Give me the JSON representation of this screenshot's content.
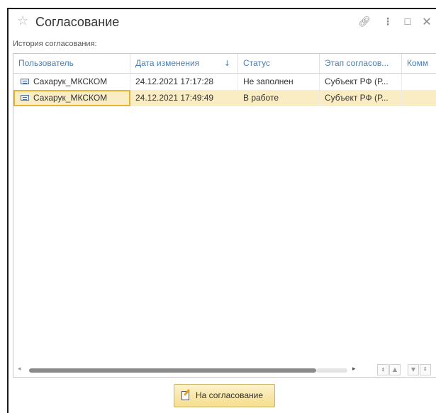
{
  "window": {
    "title": "Согласование",
    "icons": [
      "star-icon",
      "link-icon",
      "more-icon",
      "maximize-icon",
      "close-icon"
    ]
  },
  "history": {
    "label": "История согласования:",
    "columns": [
      "Пользователь",
      "Дата изменения",
      "Статус",
      "Этап согласов...",
      "Комм"
    ],
    "sort_indicator": "↓",
    "rows": [
      {
        "user": "Сахарук_МКСКОМ",
        "date": "24.12.2021 17:17:28",
        "status": "Не заполнен",
        "stage": "Субъект РФ (Р...",
        "comment": ""
      },
      {
        "user": "Сахарук_МКСКОМ",
        "date": "24.12.2021 17:49:49",
        "status": "В работе",
        "stage": "Субъект РФ (Р...",
        "comment": ""
      }
    ],
    "selected_row_color": "#fbedc3"
  },
  "actions": {
    "approve_label": "На согласование"
  },
  "colors": {
    "header_text": "#4a7fb2",
    "button_bg": "#f5de8c",
    "focus_border": "#e5b434"
  }
}
